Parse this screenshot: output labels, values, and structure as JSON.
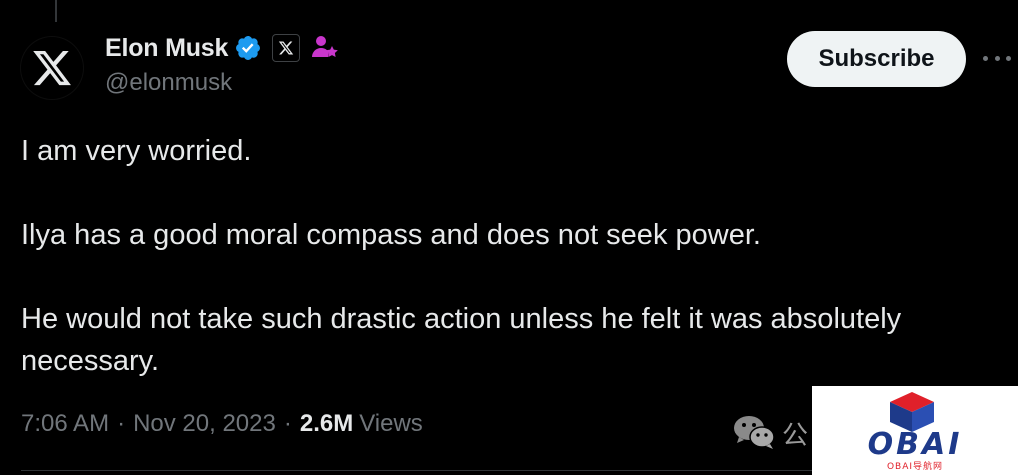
{
  "author": {
    "display_name": "Elon Musk",
    "handle": "@elonmusk",
    "avatar_icon": "x-logo-icon",
    "verified_icon": "verified-badge-icon",
    "affiliate_icon": "x-affiliate-badge-icon",
    "accent_color": "#1d9bf0"
  },
  "actions": {
    "subscribe_label": "Subscribe",
    "more_icon": "more-horizontal-icon"
  },
  "tweet": {
    "paragraphs": [
      "I am very worried.",
      "Ilya has a good moral compass and does not seek power.",
      "He would not take such drastic action unless he felt it was absolutely necessary."
    ]
  },
  "meta": {
    "time": "7:06 AM",
    "separator": "·",
    "date": "Nov 20, 2023",
    "views_count": "2.6M",
    "views_label": "Views"
  },
  "overlay": {
    "wechat_icon": "wechat-icon",
    "wechat_char": "公",
    "watermark_text": "OBAI",
    "watermark_subtext": "OBAI导航网"
  }
}
